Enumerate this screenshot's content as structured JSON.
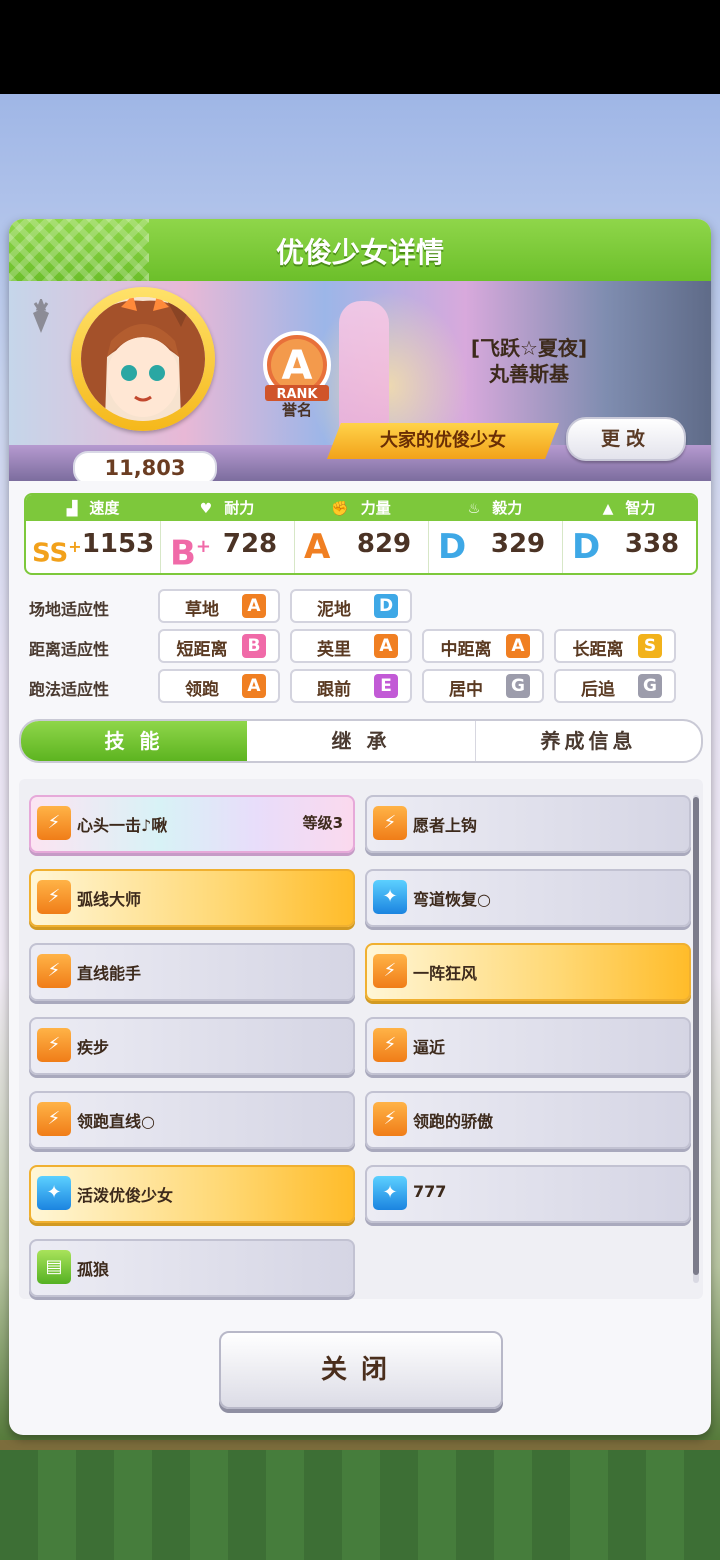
{
  "header": {
    "title": "优俊少女详情"
  },
  "profile": {
    "fans": "11,803",
    "rank_letter": "A",
    "rank_word": "RANK",
    "rank_caption": "誉名",
    "name_line1": "[飞跃☆夏夜]",
    "name_line2": "丸善斯基",
    "title_plate": "大家的优俊少女",
    "change_button": "更改"
  },
  "stats": [
    {
      "label": "速度",
      "icon": "shoe-icon",
      "grade": "SS",
      "plus": "+",
      "value": "1153",
      "color": "#f2a11b"
    },
    {
      "label": "耐力",
      "icon": "heart-icon",
      "grade": "B",
      "plus": "+",
      "value": "728",
      "color": "#f06aa8"
    },
    {
      "label": "力量",
      "icon": "muscle-icon",
      "grade": "A",
      "plus": "",
      "value": "829",
      "color": "#f07f22"
    },
    {
      "label": "毅力",
      "icon": "flame-icon",
      "grade": "D",
      "plus": "",
      "value": "329",
      "color": "#3ea8e6"
    },
    {
      "label": "智力",
      "icon": "graduation-cap-icon",
      "grade": "D",
      "plus": "",
      "value": "338",
      "color": "#3ea8e6"
    }
  ],
  "aptitude": {
    "field_label": "场地适应性",
    "distance_label": "距离适应性",
    "style_label": "跑法适应性",
    "field": [
      {
        "name": "草地",
        "grade": "A",
        "color": "#f07f22"
      },
      {
        "name": "泥地",
        "grade": "D",
        "color": "#3ea8e6"
      }
    ],
    "distance": [
      {
        "name": "短距离",
        "grade": "B",
        "color": "#f06aa8"
      },
      {
        "name": "英里",
        "grade": "A",
        "color": "#f07f22"
      },
      {
        "name": "中距离",
        "grade": "A",
        "color": "#f07f22"
      },
      {
        "name": "长距离",
        "grade": "S",
        "color": "#f2b21b"
      }
    ],
    "style": [
      {
        "name": "领跑",
        "grade": "A",
        "color": "#f07f22"
      },
      {
        "name": "跟前",
        "grade": "E",
        "color": "#c25ad6"
      },
      {
        "name": "居中",
        "grade": "G",
        "color": "#9c9cab"
      },
      {
        "name": "后追",
        "grade": "G",
        "color": "#9c9cab"
      }
    ]
  },
  "tabs": [
    "技 能",
    "继 承",
    "养成信息"
  ],
  "skills": [
    {
      "name": "心头一击♪啾",
      "level": "等级3",
      "style": "rainbow",
      "icon": "orange"
    },
    {
      "name": "愿者上钩",
      "level": "",
      "style": "plain",
      "icon": "orange"
    },
    {
      "name": "弧线大师",
      "level": "",
      "style": "gold",
      "icon": "orange"
    },
    {
      "name": "弯道恢复○",
      "level": "",
      "style": "plain",
      "icon": "blue"
    },
    {
      "name": "直线能手",
      "level": "",
      "style": "plain",
      "icon": "orange"
    },
    {
      "name": "一阵狂风",
      "level": "",
      "style": "gold",
      "icon": "orange"
    },
    {
      "name": "疾步",
      "level": "",
      "style": "plain",
      "icon": "orange"
    },
    {
      "name": "逼近",
      "level": "",
      "style": "plain",
      "icon": "orange"
    },
    {
      "name": "领跑直线○",
      "level": "",
      "style": "plain",
      "icon": "orange"
    },
    {
      "name": "领跑的骄傲",
      "level": "",
      "style": "plain",
      "icon": "orange"
    },
    {
      "name": "活泼优俊少女",
      "level": "",
      "style": "gold",
      "icon": "blue"
    },
    {
      "name": "777",
      "level": "",
      "style": "plain",
      "icon": "blue"
    },
    {
      "name": "孤狼",
      "level": "",
      "style": "plain",
      "icon": "green"
    }
  ],
  "close_button": "关闭"
}
